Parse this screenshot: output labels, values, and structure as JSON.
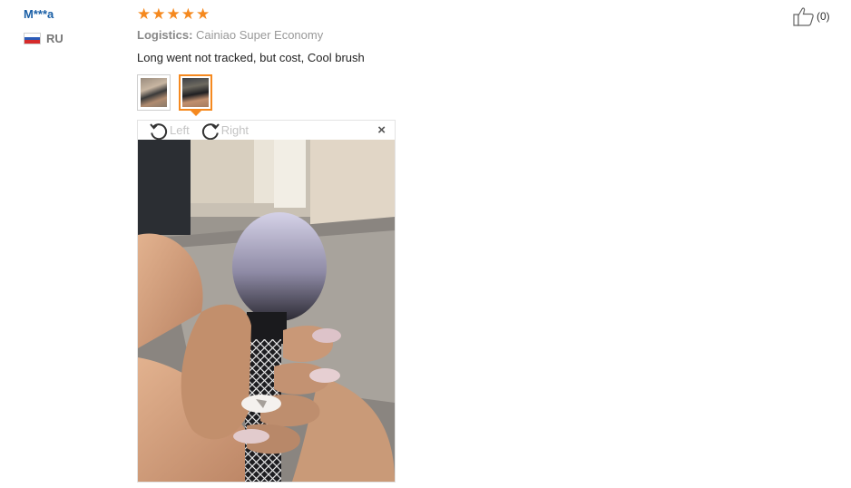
{
  "reviewer": {
    "name": "M***a",
    "country_code": "RU"
  },
  "rating": {
    "stars": 5,
    "star_color": "#f5891f"
  },
  "logistics": {
    "label": "Logistics:",
    "value": "Cainiao Super Economy"
  },
  "review": {
    "text": "Long went not tracked, but cost, Cool brush"
  },
  "helpful": {
    "count": "(0)",
    "icon": "thumbs-up-icon"
  },
  "thumbnails": [
    {
      "name": "review-photo-1",
      "selected": false
    },
    {
      "name": "review-photo-2",
      "selected": true
    }
  ],
  "viewer": {
    "rotate_left_label": "Left",
    "rotate_right_label": "Right",
    "close_glyph": "×"
  },
  "colors": {
    "accent": "#f5891f",
    "link": "#1a5fa6"
  }
}
